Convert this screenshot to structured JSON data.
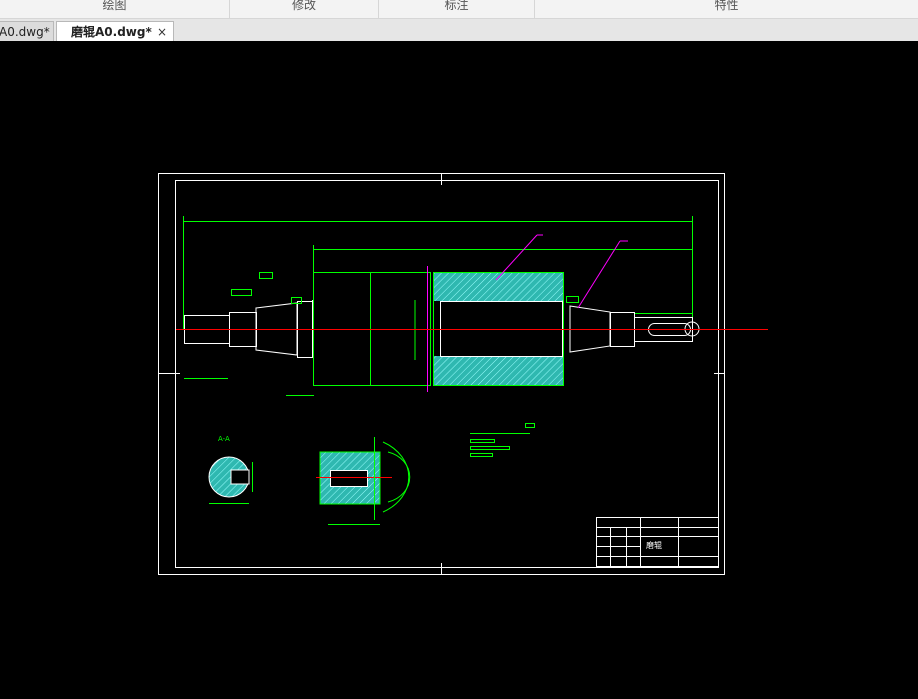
{
  "ribbon": {
    "panels": [
      {
        "label": "绘图"
      },
      {
        "label": "修改"
      },
      {
        "label": "标注"
      },
      {
        "label": "特性"
      }
    ]
  },
  "tabs": [
    {
      "label": "A0.dwg*",
      "active": false
    },
    {
      "label": "磨辊A0.dwg*",
      "active": true
    }
  ],
  "tab_close_glyph": "×",
  "drawing": {
    "title_block_name": "磨辊",
    "section_label": "A-A",
    "colors": {
      "background": "#000000",
      "frame": "#ffffff",
      "geometry": "#00ff00",
      "centerline": "#ff0000",
      "leader": "#ff00ff",
      "hatch": "#2fb8b0"
    }
  }
}
